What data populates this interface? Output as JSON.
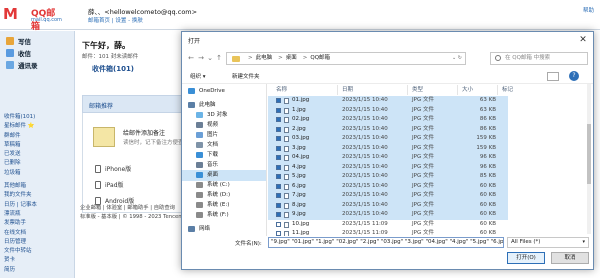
{
  "header": {
    "logo_letter": "M",
    "logo_brand": "QQ邮箱",
    "logo_domain": "mail.qq.com",
    "user": "薛、、<hellowelcometo@qq.com>",
    "links": "邮箱首页 | 设置 - 换肤",
    "right": "帮助"
  },
  "sidebar": {
    "actions": [
      {
        "label": "写信",
        "color": "#e8a53a"
      },
      {
        "label": "收信",
        "color": "#5a9be0"
      },
      {
        "label": "通讯录",
        "color": "#6aa7e2"
      }
    ],
    "links": [
      "收件箱(101)",
      "星标邮件 ⭐",
      "群邮件",
      "草稿箱",
      "已发送",
      "已删除",
      "垃圾箱",
      "其他邮箱",
      "我的文件夹",
      "日历 | 记事本",
      "漂流瓶",
      "发票助手",
      "在线文档",
      "日历管理",
      "文件中转站",
      "贺卡",
      "简历"
    ]
  },
  "main": {
    "greeting": "下午好，薛。",
    "greeting_sub": "邮件：101 封未读邮件",
    "inbox_title": "收件箱(101)",
    "recommend_title": "邮箱推荐",
    "rec_card_title": "给邮件添加备注",
    "rec_card_desc": "读信时，记下备注方便查找",
    "platforms": [
      "iPhone版",
      "iPad版",
      "Android版"
    ],
    "footer_links": "企业邮箱 | 体验室 | 邮箱助手 | 自助查询",
    "footer_extra": "标准版 - 基本版 | © 1998 - 2023 Tencent"
  },
  "dialog": {
    "title": "打开",
    "close": "✕",
    "nav_back": "←",
    "nav_forward": "→",
    "nav_down": "⌄",
    "nav_up": "↑",
    "breadcrumb": [
      "此电脑",
      "桌面",
      "QQ邮箱"
    ],
    "crumb_sep": ">",
    "addr_dropdown": "⌄",
    "addr_refresh": "↻",
    "search_placeholder": "在 QQ邮箱 中搜索",
    "toolbar": {
      "organize": "组织 ▾",
      "new_folder": "新建文件夹",
      "help": "?"
    },
    "nav_items": [
      {
        "label": "OneDrive",
        "color": "#3a8fd6"
      },
      {
        "label": "此电脑",
        "color": "#5b7fa6"
      },
      {
        "label": "3D 对象",
        "color": "#6cb4e6"
      },
      {
        "label": "视频",
        "color": "#6b7f96"
      },
      {
        "label": "图片",
        "color": "#6b9fd6"
      },
      {
        "label": "文档",
        "color": "#7f93a8"
      },
      {
        "label": "下载",
        "color": "#3a8fd6"
      },
      {
        "label": "音乐",
        "color": "#6b7f96"
      },
      {
        "label": "桌面",
        "color": "#3a8fd6"
      },
      {
        "label": "系统 (C:)",
        "color": "#8a8a8a"
      },
      {
        "label": "系统 (D:)",
        "color": "#8a8a8a"
      },
      {
        "label": "系统 (E:)",
        "color": "#8a8a8a"
      },
      {
        "label": "系统 (F:)",
        "color": "#8a8a8a"
      },
      {
        "label": "网络",
        "color": "#5b7fa6"
      }
    ],
    "columns": {
      "name": "名称",
      "date": "日期",
      "type": "类型",
      "size": "大小",
      "tags": "标记"
    },
    "files": [
      {
        "name": "01.jpg",
        "date": "2023/1/15 10:40",
        "type": "JPG 文件",
        "size": "63 KB",
        "selected": true
      },
      {
        "name": "1.jpg",
        "date": "2023/1/15 10:40",
        "type": "JPG 文件",
        "size": "63 KB",
        "selected": true
      },
      {
        "name": "02.jpg",
        "date": "2023/1/15 10:40",
        "type": "JPG 文件",
        "size": "86 KB",
        "selected": true
      },
      {
        "name": "2.jpg",
        "date": "2023/1/15 10:40",
        "type": "JPG 文件",
        "size": "86 KB",
        "selected": true
      },
      {
        "name": "03.jpg",
        "date": "2023/1/15 10:40",
        "type": "JPG 文件",
        "size": "159 KB",
        "selected": true
      },
      {
        "name": "3.jpg",
        "date": "2023/1/15 10:40",
        "type": "JPG 文件",
        "size": "159 KB",
        "selected": true
      },
      {
        "name": "04.jpg",
        "date": "2023/1/15 10:40",
        "type": "JPG 文件",
        "size": "96 KB",
        "selected": true
      },
      {
        "name": "4.jpg",
        "date": "2023/1/15 10:40",
        "type": "JPG 文件",
        "size": "96 KB",
        "selected": true
      },
      {
        "name": "5.jpg",
        "date": "2023/1/15 10:40",
        "type": "JPG 文件",
        "size": "85 KB",
        "selected": true
      },
      {
        "name": "6.jpg",
        "date": "2023/1/15 10:40",
        "type": "JPG 文件",
        "size": "60 KB",
        "selected": true
      },
      {
        "name": "7.jpg",
        "date": "2023/1/15 10:40",
        "type": "JPG 文件",
        "size": "60 KB",
        "selected": true
      },
      {
        "name": "8.jpg",
        "date": "2023/1/15 10:40",
        "type": "JPG 文件",
        "size": "60 KB",
        "selected": true
      },
      {
        "name": "9.jpg",
        "date": "2023/1/15 10:40",
        "type": "JPG 文件",
        "size": "60 KB",
        "selected": true
      },
      {
        "name": "10.jpg",
        "date": "2023/1/15 11:09",
        "type": "JPG 文件",
        "size": "60 KB",
        "selected": false
      },
      {
        "name": "11.jpg",
        "date": "2023/1/15 11:09",
        "type": "JPG 文件",
        "size": "60 KB",
        "selected": false
      }
    ],
    "filename_label": "文件名(N):",
    "filename_value": "\"9.jpg\" \"01.jpg\" \"1.jpg\" \"02.jpg\" \"2.jpg\" \"03.jpg\" \"3.jpg\" \"04.jpg\" \"4.jpg\" \"5.jpg\" \"6.jpg\" \"7",
    "filter": "All Files (*)",
    "open_button": "打开(O)",
    "cancel_button": "取消"
  }
}
